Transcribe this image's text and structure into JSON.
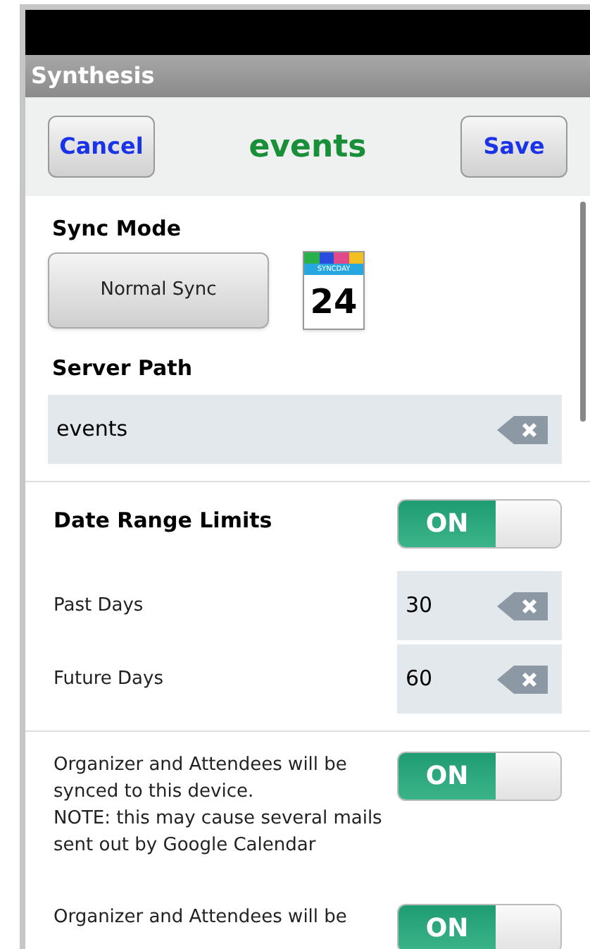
{
  "window": {
    "title": "Synthesis"
  },
  "header": {
    "cancel": "Cancel",
    "title": "events",
    "save": "Save"
  },
  "sync_mode": {
    "label": "Sync Mode",
    "button": "Normal Sync",
    "calendar_icon": {
      "banner": "SYNCDAY",
      "day": "24"
    }
  },
  "server_path": {
    "label": "Server Path",
    "value": "events"
  },
  "date_range": {
    "label": "Date Range Limits",
    "toggle": {
      "text": "ON",
      "on": true
    },
    "fields": [
      {
        "label": "Past Days",
        "value": "30"
      },
      {
        "label": "Future Days",
        "value": "60"
      }
    ]
  },
  "options": [
    {
      "text": "Organizer and Attendees will be synced to this device.\nNOTE: this may cause several mails sent out by Google Calendar",
      "toggle": {
        "text": "ON",
        "on": true
      }
    },
    {
      "text": "Organizer and Attendees will be",
      "toggle": {
        "text": "ON",
        "on": true
      }
    }
  ]
}
